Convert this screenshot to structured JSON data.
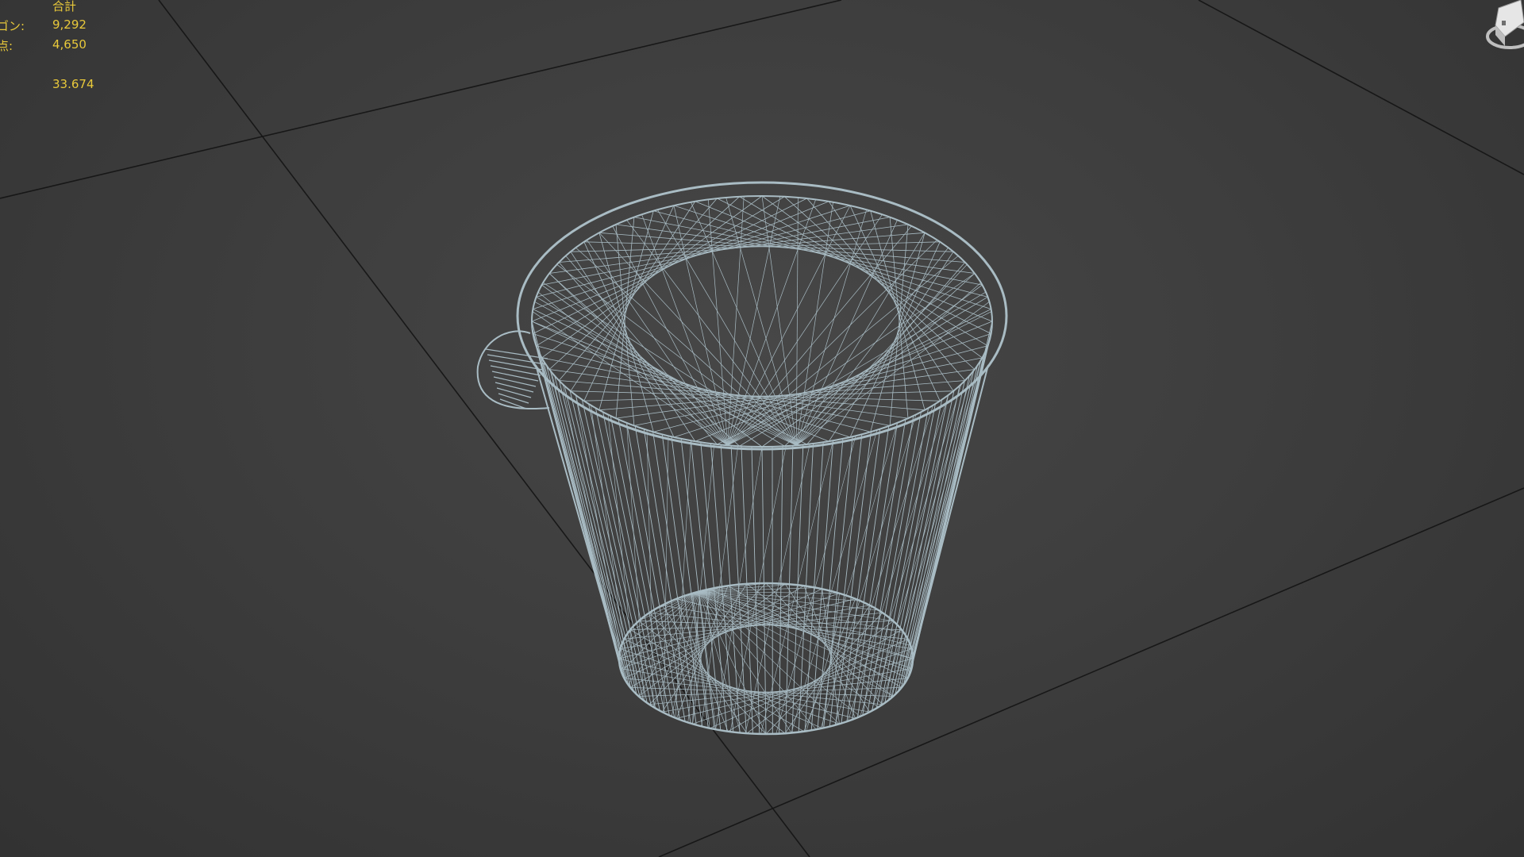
{
  "stats": {
    "header": "合計",
    "rows": [
      {
        "label": "ゴン:",
        "value": "9,292"
      },
      {
        "label": "点:",
        "value": "4,650"
      },
      {
        "label": "",
        "value": ""
      },
      {
        "label": ":",
        "value": "33.674"
      }
    ]
  },
  "colors": {
    "stats_text": "#e9c93a",
    "wire": "#a9bcc4",
    "grid_line": "#141414",
    "background": "#3e3e3e"
  },
  "icons": {
    "viewcube": "viewcube-icon"
  }
}
